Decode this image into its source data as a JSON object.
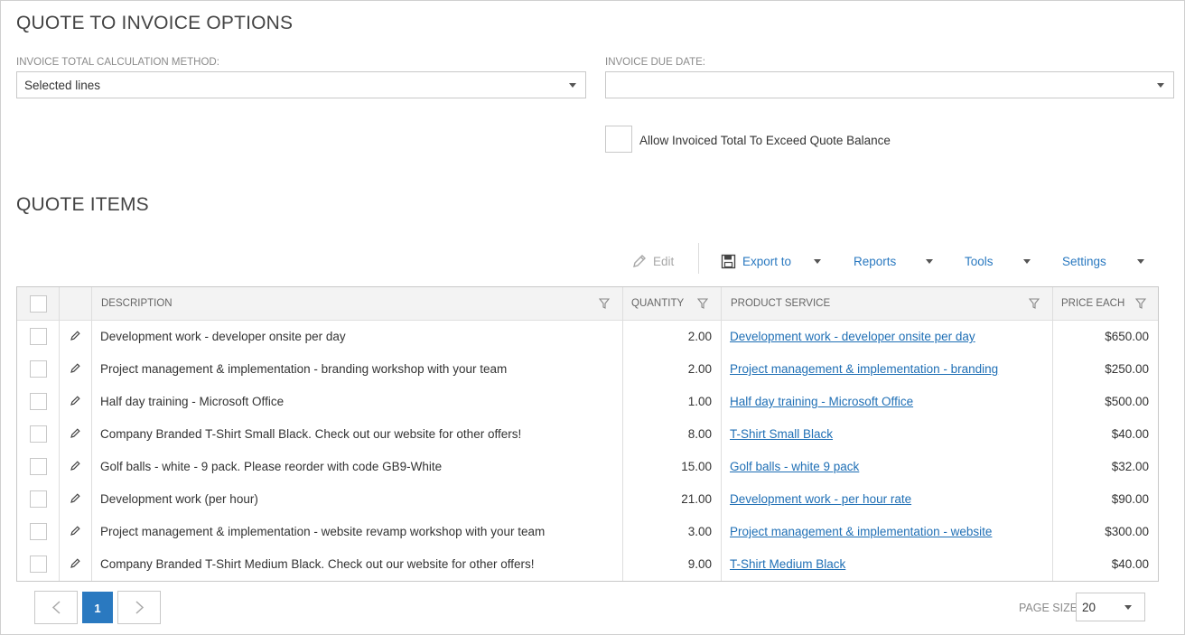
{
  "options": {
    "title": "QUOTE TO INVOICE OPTIONS",
    "calc_method": {
      "label": "INVOICE TOTAL CALCULATION METHOD:",
      "value": "Selected lines"
    },
    "due_date": {
      "label": "INVOICE DUE DATE:",
      "value": ""
    },
    "allow_exceed": {
      "label": "Allow Invoiced Total To Exceed Quote Balance",
      "checked": false
    }
  },
  "items": {
    "title": "QUOTE ITEMS",
    "toolbar": {
      "edit": "Edit",
      "export": "Export to",
      "reports": "Reports",
      "tools": "Tools",
      "settings": "Settings"
    },
    "columns": {
      "description": "DESCRIPTION",
      "quantity": "QUANTITY",
      "product_service": "PRODUCT SERVICE",
      "price_each": "PRICE EACH"
    },
    "rows": [
      {
        "description": "Development work - developer onsite per day",
        "quantity": "2.00",
        "product": "Development work - developer onsite per day",
        "price": "$650.00"
      },
      {
        "description": "Project management & implementation - branding workshop with your team",
        "quantity": "2.00",
        "product": "Project management & implementation - branding",
        "price": "$250.00"
      },
      {
        "description": "Half day training - Microsoft Office",
        "quantity": "1.00",
        "product": "Half day training - Microsoft Office",
        "price": "$500.00"
      },
      {
        "description": "Company Branded T-Shirt Small Black. Check out our website for other offers!",
        "quantity": "8.00",
        "product": "T-Shirt Small Black",
        "price": "$40.00"
      },
      {
        "description": "Golf balls - white - 9 pack. Please reorder with code GB9-White",
        "quantity": "15.00",
        "product": "Golf balls - white 9 pack",
        "price": "$32.00"
      },
      {
        "description": "Development work (per hour)",
        "quantity": "21.00",
        "product": "Development work - per hour rate",
        "price": "$90.00"
      },
      {
        "description": "Project management & implementation - website revamp workshop with your team",
        "quantity": "3.00",
        "product": "Project management & implementation - website",
        "price": "$300.00"
      },
      {
        "description": "Company Branded T-Shirt Medium Black. Check out our website for other offers!",
        "quantity": "9.00",
        "product": "T-Shirt Medium Black",
        "price": "$40.00"
      }
    ]
  },
  "pager": {
    "current_page": "1",
    "page_size_label": "PAGE SIZE",
    "page_size": "20"
  },
  "colors": {
    "accent": "#2a79c0",
    "link": "#1f6fb5"
  }
}
